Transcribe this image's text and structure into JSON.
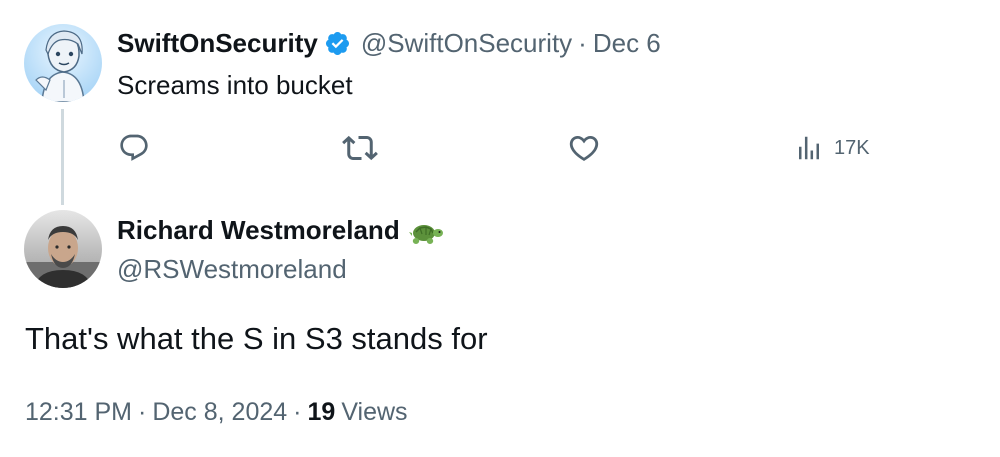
{
  "parent_tweet": {
    "author": {
      "display_name": "SwiftOnSecurity",
      "handle": "@SwiftOnSecurity",
      "verified": true,
      "avatar": "taylor-swift-illustration-avatar"
    },
    "separator": "·",
    "date": "Dec 6",
    "text": "Screams into bucket",
    "actions": {
      "reply_icon": "reply-bubble-icon",
      "retweet_icon": "retweet-icon",
      "like_icon": "heart-icon",
      "views_icon": "views-bar-chart-icon",
      "views_count": "17K"
    }
  },
  "reply_tweet": {
    "author": {
      "display_name": "Richard Westmoreland",
      "handle": "@RSWestmoreland",
      "badge_icon": "turtle-emoji",
      "avatar": "man-photo-avatar"
    },
    "text": "That's what the S in S3 stands for",
    "time": "12:31 PM",
    "separator": "·",
    "date": "Dec 8, 2024",
    "views_number": "19",
    "views_label": "Views"
  },
  "colors": {
    "text_primary": "#0f1419",
    "text_secondary": "#536471",
    "verified_blue": "#1d9bf0",
    "thread_line": "#cfd9de"
  }
}
